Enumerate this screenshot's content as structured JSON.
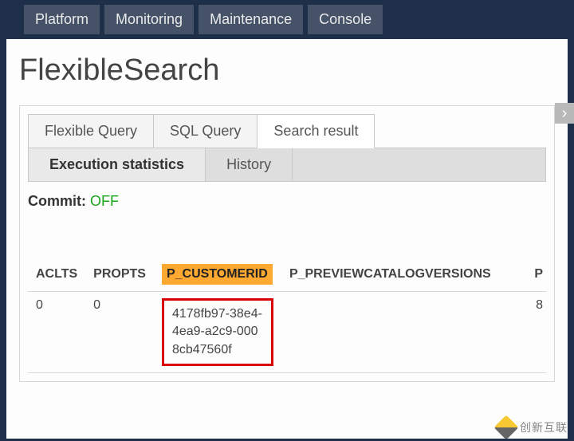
{
  "nav": {
    "items": [
      "Platform",
      "Monitoring",
      "Maintenance",
      "Console"
    ]
  },
  "page": {
    "title": "FlexibleSearch"
  },
  "tabs": {
    "top": [
      {
        "label": "Flexible Query"
      },
      {
        "label": "SQL Query"
      },
      {
        "label": "Search result"
      }
    ],
    "sub": [
      {
        "label": "Execution statistics"
      },
      {
        "label": "History"
      }
    ]
  },
  "commit": {
    "label": "Commit:",
    "value": "OFF"
  },
  "table": {
    "columns": [
      "ACLTS",
      "PROPTS",
      "P_CUSTOMERID",
      "P_PREVIEWCATALOGVERSIONS",
      "P"
    ],
    "rows": [
      {
        "ACLTS": "0",
        "PROPTS": "0",
        "P_CUSTOMERID": "4178fb97-38e4-4ea9-a2c9-0008cb47560f",
        "P_PREVIEWCATALOGVERSIONS": "",
        "P": "8"
      }
    ]
  },
  "arrow": {
    "glyph": "›"
  },
  "watermark": {
    "text": "创新互联"
  }
}
